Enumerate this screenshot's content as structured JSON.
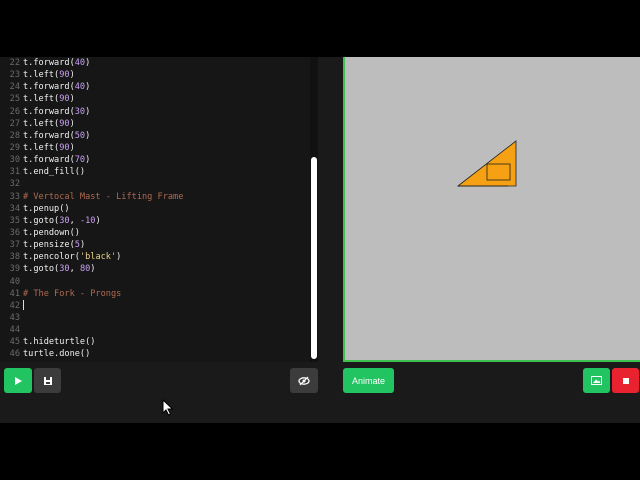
{
  "editor": {
    "lines": [
      {
        "n": "22",
        "t": [
          {
            "c": "code",
            "s": "t.forward("
          },
          {
            "c": "num",
            "s": "40"
          },
          {
            "c": "code",
            "s": ")"
          }
        ]
      },
      {
        "n": "23",
        "t": [
          {
            "c": "code",
            "s": "t.left("
          },
          {
            "c": "num",
            "s": "90"
          },
          {
            "c": "code",
            "s": ")"
          }
        ]
      },
      {
        "n": "24",
        "t": [
          {
            "c": "code",
            "s": "t.forward("
          },
          {
            "c": "num",
            "s": "40"
          },
          {
            "c": "code",
            "s": ")"
          }
        ]
      },
      {
        "n": "25",
        "t": [
          {
            "c": "code",
            "s": "t.left("
          },
          {
            "c": "num",
            "s": "90"
          },
          {
            "c": "code",
            "s": ")"
          }
        ]
      },
      {
        "n": "26",
        "t": [
          {
            "c": "code",
            "s": "t.forward("
          },
          {
            "c": "num",
            "s": "30"
          },
          {
            "c": "code",
            "s": ")"
          }
        ]
      },
      {
        "n": "27",
        "t": [
          {
            "c": "code",
            "s": "t.left("
          },
          {
            "c": "num",
            "s": "90"
          },
          {
            "c": "code",
            "s": ")"
          }
        ]
      },
      {
        "n": "28",
        "t": [
          {
            "c": "code",
            "s": "t.forward("
          },
          {
            "c": "num",
            "s": "50"
          },
          {
            "c": "code",
            "s": ")"
          }
        ]
      },
      {
        "n": "29",
        "t": [
          {
            "c": "code",
            "s": "t.left("
          },
          {
            "c": "num",
            "s": "90"
          },
          {
            "c": "code",
            "s": ")"
          }
        ]
      },
      {
        "n": "30",
        "t": [
          {
            "c": "code",
            "s": "t.forward("
          },
          {
            "c": "num",
            "s": "70"
          },
          {
            "c": "code",
            "s": ")"
          }
        ]
      },
      {
        "n": "31",
        "t": [
          {
            "c": "code",
            "s": "t.end_fill()"
          }
        ]
      },
      {
        "n": "32",
        "t": []
      },
      {
        "n": "33",
        "t": [
          {
            "c": "com",
            "s": "# Vertocal Mast - Lifting Frame"
          }
        ]
      },
      {
        "n": "34",
        "t": [
          {
            "c": "code",
            "s": "t.penup()"
          }
        ]
      },
      {
        "n": "35",
        "t": [
          {
            "c": "code",
            "s": "t.goto("
          },
          {
            "c": "num",
            "s": "30"
          },
          {
            "c": "code",
            "s": ", "
          },
          {
            "c": "num",
            "s": "-10"
          },
          {
            "c": "code",
            "s": ")"
          }
        ]
      },
      {
        "n": "36",
        "t": [
          {
            "c": "code",
            "s": "t.pendown()"
          }
        ]
      },
      {
        "n": "37",
        "t": [
          {
            "c": "code",
            "s": "t.pensize("
          },
          {
            "c": "num",
            "s": "5"
          },
          {
            "c": "code",
            "s": ")"
          }
        ]
      },
      {
        "n": "38",
        "t": [
          {
            "c": "code",
            "s": "t.pencolor("
          },
          {
            "c": "str",
            "s": "'black'"
          },
          {
            "c": "code",
            "s": ")"
          }
        ]
      },
      {
        "n": "39",
        "t": [
          {
            "c": "code",
            "s": "t.goto("
          },
          {
            "c": "num",
            "s": "30"
          },
          {
            "c": "code",
            "s": ", "
          },
          {
            "c": "num",
            "s": "80"
          },
          {
            "c": "code",
            "s": ")"
          }
        ]
      },
      {
        "n": "40",
        "t": []
      },
      {
        "n": "41",
        "t": [
          {
            "c": "com",
            "s": "# The Fork - Prongs"
          }
        ]
      },
      {
        "n": "42",
        "t": [],
        "cursor": true
      },
      {
        "n": "43",
        "t": []
      },
      {
        "n": "44",
        "t": []
      },
      {
        "n": "45",
        "t": [
          {
            "c": "code",
            "s": "t.hideturtle()"
          }
        ]
      },
      {
        "n": "46",
        "t": [
          {
            "c": "code",
            "s": "turtle.done()"
          }
        ]
      }
    ]
  },
  "toolbar": {
    "run_icon": "play-icon",
    "save_icon": "save-icon",
    "view_icon": "eye-slash-icon",
    "animate_label": "Animate",
    "image_icon": "image-icon",
    "stop_icon": "stop-icon"
  },
  "canvas": {
    "background": "#bdbdbd",
    "border_color": "#3ec24f",
    "fill_color": "#f5a113"
  },
  "colors": {
    "accent_green": "#22c462",
    "stop_red": "#e8232f"
  }
}
